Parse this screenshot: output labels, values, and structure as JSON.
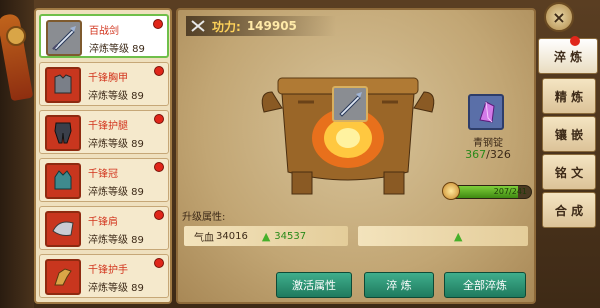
{
  "power": {
    "label": "功力:",
    "value": "149905"
  },
  "items": [
    {
      "name": "百战剑",
      "level": "淬炼等级 89",
      "icon": "sword-icon",
      "selected": true
    },
    {
      "name": "千锋胸甲",
      "level": "淬炼等级 89",
      "icon": "chest-armor-icon",
      "selected": false
    },
    {
      "name": "千锋护腿",
      "level": "淬炼等级 89",
      "icon": "leg-armor-icon",
      "selected": false
    },
    {
      "name": "千锋冠",
      "level": "淬炼等级 89",
      "icon": "crown-icon",
      "selected": false
    },
    {
      "name": "千锋肩",
      "level": "淬炼等级 89",
      "icon": "shoulder-armor-icon",
      "selected": false
    },
    {
      "name": "千锋护手",
      "level": "淬炼等级 89",
      "icon": "gauntlet-icon",
      "selected": false
    }
  ],
  "material": {
    "name": "青钢锭",
    "have": "367",
    "need": "/326"
  },
  "progress": {
    "fraction": 0.85,
    "text": "207/241"
  },
  "upgrade": {
    "label": "升级属性:",
    "attr_name": "气血",
    "current": "34016",
    "next": "34537"
  },
  "buttons": {
    "activate": "激活属性",
    "refine": "淬 炼",
    "refine_all": "全部淬炼"
  },
  "tabs": [
    "淬 炼",
    "精 炼",
    "镶 嵌",
    "铭 文",
    "合 成"
  ],
  "close_label": "×",
  "colors": {
    "accent_green": "#3fae8c",
    "red_name": "#d2331c",
    "have_green": "#2a8a1a"
  }
}
